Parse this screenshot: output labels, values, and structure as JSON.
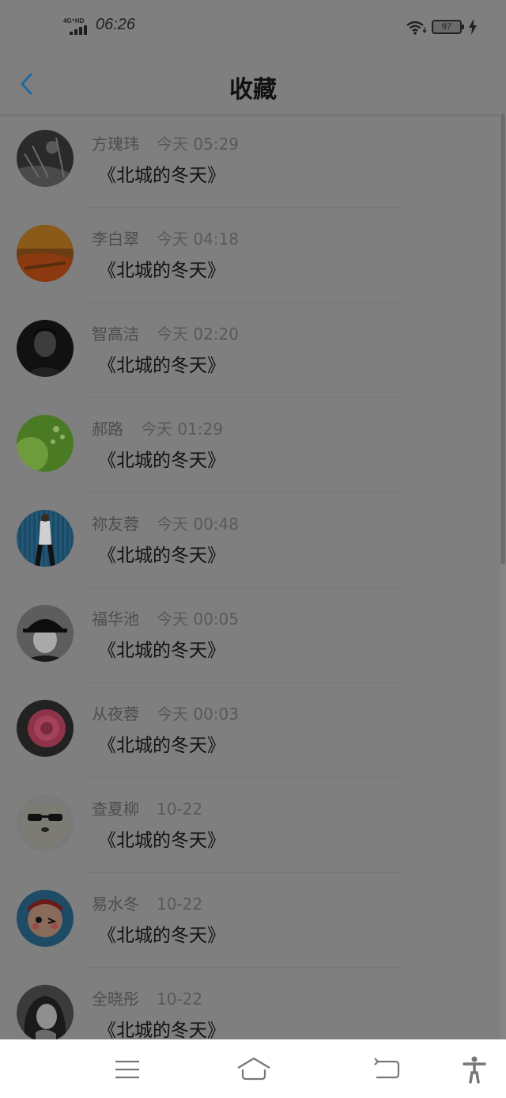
{
  "status_bar": {
    "network": "4G⁺HD",
    "time": "06:26",
    "battery": "97"
  },
  "header": {
    "title": "收藏"
  },
  "favorites": [
    {
      "name": "方瑰玮",
      "time": "今天 05:29",
      "title": "《北城的冬天》"
    },
    {
      "name": "李白翠",
      "time": "今天 04:18",
      "title": "《北城的冬天》"
    },
    {
      "name": "智高洁",
      "time": "今天 02:20",
      "title": "《北城的冬天》"
    },
    {
      "name": "郝路",
      "time": "今天 01:29",
      "title": "《北城的冬天》"
    },
    {
      "name": "祢友蓉",
      "time": "今天 00:48",
      "title": "《北城的冬天》"
    },
    {
      "name": "福华池",
      "time": "今天 00:05",
      "title": "《北城的冬天》"
    },
    {
      "name": "从夜蓉",
      "time": "今天 00:03",
      "title": "《北城的冬天》"
    },
    {
      "name": "查夏柳",
      "time": "10-22",
      "title": "《北城的冬天》"
    },
    {
      "name": "易水冬",
      "time": "10-22",
      "title": "《北城的冬天》"
    },
    {
      "name": "全晓彤",
      "time": "10-22",
      "title": "《北城的冬天》"
    }
  ],
  "icons": {
    "back": "chevron-left-icon",
    "menu": "menu-icon",
    "home": "home-icon",
    "return": "return-icon",
    "accessibility": "accessibility-icon"
  },
  "colors": {
    "accent": "#1c6aa3",
    "overlay": "#7f7f7f"
  }
}
